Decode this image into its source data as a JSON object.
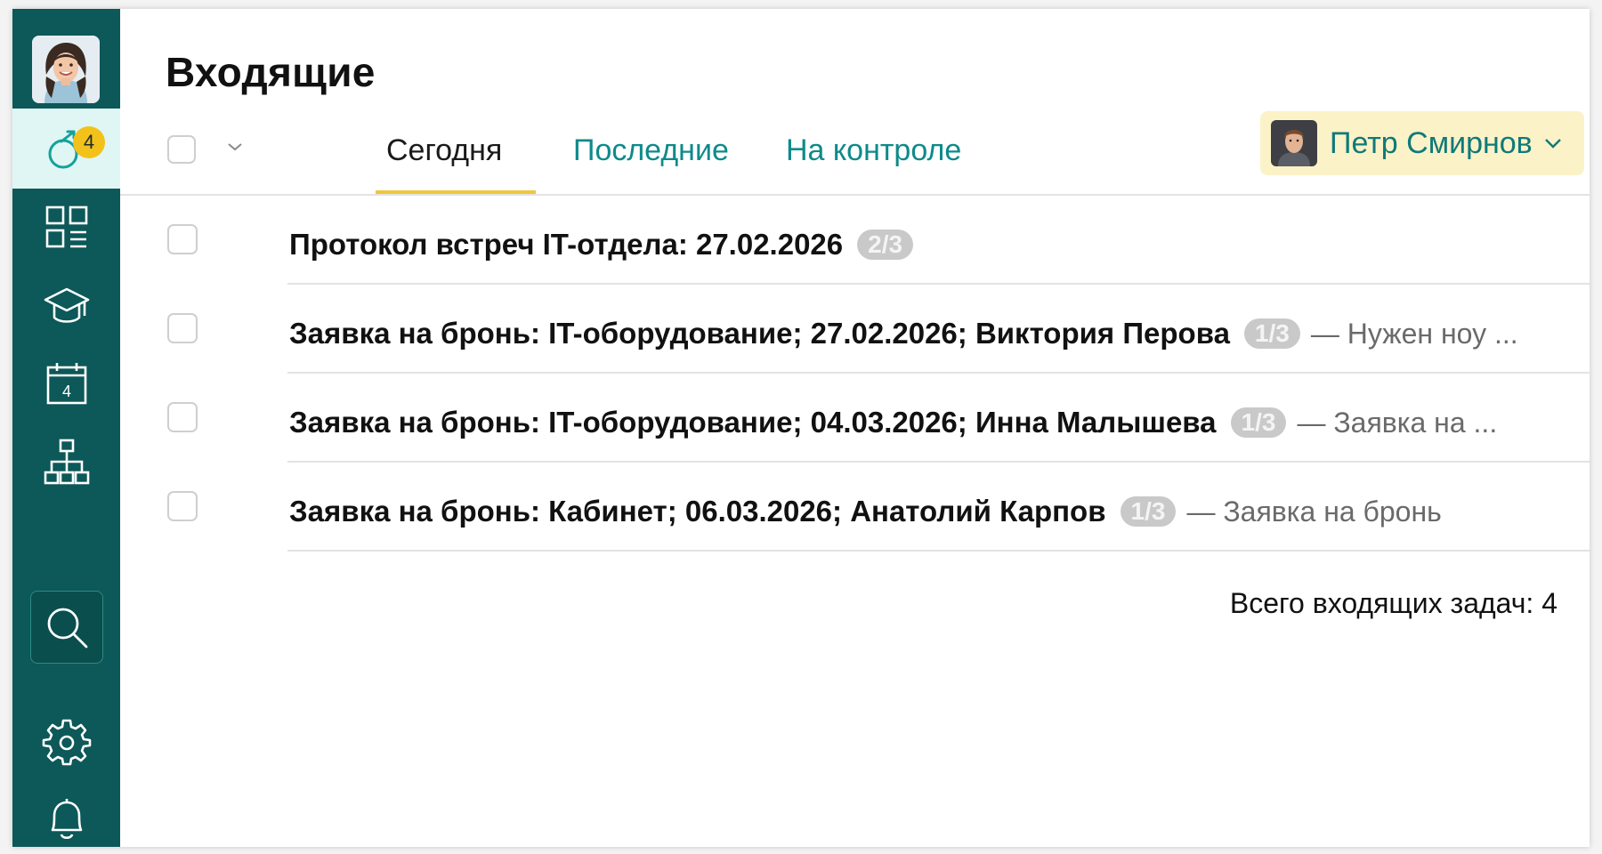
{
  "page": {
    "title": "Входящие"
  },
  "sidebar": {
    "items": [
      {
        "name": "tasks",
        "icon": "tasks-icon",
        "badge": "4",
        "active": true
      },
      {
        "name": "dashboard",
        "icon": "dashboard-icon"
      },
      {
        "name": "learning",
        "icon": "graduation-cap-icon"
      },
      {
        "name": "calendar",
        "icon": "calendar-icon",
        "day": "4"
      },
      {
        "name": "org-structure",
        "icon": "org-chart-icon"
      },
      {
        "name": "search",
        "icon": "search-icon"
      },
      {
        "name": "settings",
        "icon": "gear-icon"
      },
      {
        "name": "notifications",
        "icon": "bell-icon"
      }
    ]
  },
  "tabs": [
    {
      "label": "Сегодня",
      "active": true
    },
    {
      "label": "Последние",
      "active": false
    },
    {
      "label": "На контроле",
      "active": false
    }
  ],
  "user": {
    "name": "Петр Смирнов"
  },
  "tasks": [
    {
      "title": "Протокол встреч IT-отдела: 27.02.2026",
      "count": "2/3",
      "preview": ""
    },
    {
      "title": "Заявка на бронь: IT-оборудование; 27.02.2026; Виктория Перова",
      "count": "1/3",
      "preview": "— Нужен ноу ..."
    },
    {
      "title": "Заявка на бронь: IT-оборудование; 04.03.2026; Инна Малышева",
      "count": "1/3",
      "preview": "— Заявка на ..."
    },
    {
      "title": "Заявка на бронь: Кабинет; 06.03.2026; Анатолий Карпов",
      "count": "1/3",
      "preview": "— Заявка на бронь"
    }
  ],
  "footer": {
    "total": "Всего входящих задач: 4"
  },
  "colors": {
    "sidebar": "#0d5858",
    "accent": "#0e8a8a",
    "tab_underline": "#f0c63b",
    "badge": "#f2c21b"
  }
}
